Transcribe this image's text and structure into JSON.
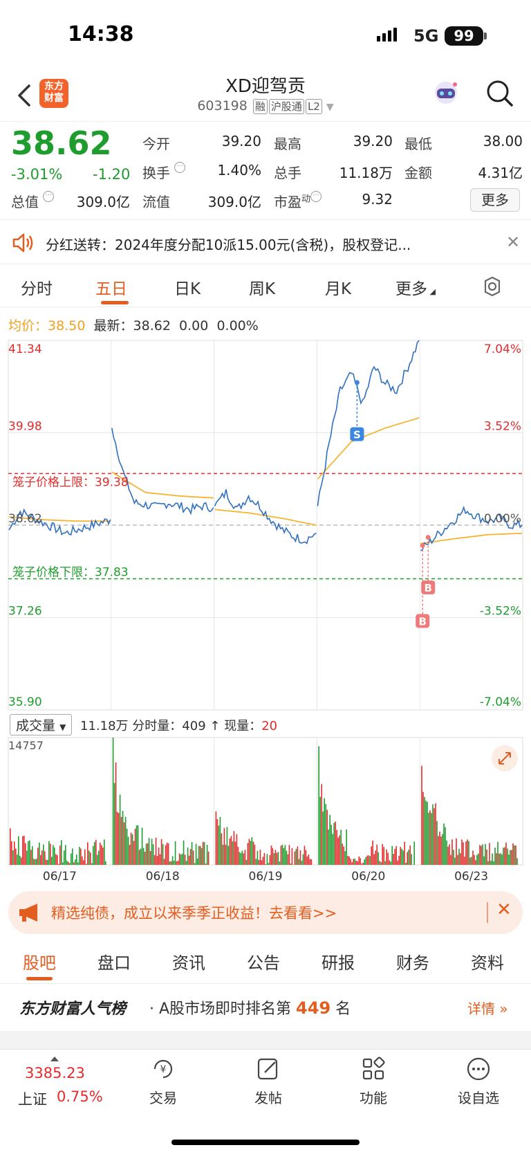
{
  "status_bar": {
    "time": "14:38",
    "network": "5G",
    "battery": "99"
  },
  "header": {
    "logo_line1": "东方",
    "logo_line2": "财富",
    "stock_name": "XD迎驾贡",
    "stock_code": "603198",
    "tags": [
      "融",
      "沪股通",
      "L2"
    ]
  },
  "quote": {
    "price": "38.62",
    "change_pct": "-3.01%",
    "change": "-1.20",
    "open_label": "今开",
    "open": "39.20",
    "high_label": "最高",
    "high": "39.20",
    "low_label": "最低",
    "low": "38.00",
    "turnover_label": "换手",
    "turnover": "1.40%",
    "volume_label": "总手",
    "volume": "11.18万",
    "amount_label": "金额",
    "amount": "4.31亿",
    "mktcap_label": "总值",
    "mktcap": "309.0亿",
    "float_label": "流值",
    "float": "309.0亿",
    "pe_label": "市盈",
    "pe_sup": "动",
    "pe": "9.32",
    "more": "更多"
  },
  "notice": {
    "text": "分红送转：2024年度分配10派15.00元(含税)，股权登记..."
  },
  "chart_tabs": [
    "分时",
    "五日",
    "日K",
    "周K",
    "月K",
    "更多"
  ],
  "stats_line": {
    "avg_label": "均价：",
    "avg": "38.50",
    "latest_label": "最新：",
    "latest": "38.62",
    "chg": "0.00",
    "pct": "0.00%"
  },
  "chart_data": {
    "type": "line",
    "title": "",
    "x": [
      "06/17",
      "06/18",
      "06/19",
      "06/20",
      "06/23"
    ],
    "ylim": [
      35.9,
      41.34
    ],
    "y_ticks_left": [
      "41.34",
      "39.98",
      "38.62",
      "37.26",
      "35.90"
    ],
    "y_ticks_right": [
      "7.04%",
      "3.52%",
      "0.00%",
      "-3.52%",
      "-7.04%"
    ],
    "annotations": {
      "upper_limit": "笼子价格上限：39.38",
      "lower_limit": "笼子价格下限：37.83",
      "sell": "S",
      "buy": "B"
    },
    "reference_lines": {
      "upper": 39.38,
      "lower": 37.83,
      "prev_close": 38.62
    },
    "series": [
      {
        "name": "最新",
        "points_per_day": [
          [
            38.55,
            38.82,
            38.74,
            38.66,
            38.58,
            38.5,
            38.55,
            38.6,
            38.65,
            38.7
          ],
          [
            40.05,
            39.4,
            38.95,
            38.92,
            38.88,
            38.95,
            38.9,
            38.85,
            38.9,
            38.88
          ],
          [
            38.9,
            39.1,
            38.85,
            39.05,
            38.9,
            38.7,
            38.55,
            38.45,
            38.4,
            38.5
          ],
          [
            38.9,
            39.8,
            40.6,
            40.85,
            40.4,
            40.95,
            40.7,
            40.6,
            40.95,
            41.34
          ],
          [
            38.25,
            38.4,
            38.55,
            38.7,
            38.85,
            38.75,
            38.68,
            38.72,
            38.62,
            38.62
          ]
        ]
      },
      {
        "name": "均价",
        "points_per_day": [
          [
            38.74,
            38.7,
            38.68,
            38.68
          ],
          [
            39.4,
            39.1,
            39.05,
            39.02
          ],
          [
            38.85,
            38.8,
            38.72,
            38.62
          ],
          [
            39.3,
            39.85,
            40.05,
            40.2
          ],
          [
            38.35,
            38.42,
            38.48,
            38.5
          ]
        ]
      }
    ]
  },
  "volume": {
    "selector": "成交量",
    "total": "11.18万",
    "tick_label": "分时量：",
    "tick": "409",
    "arrow": "↑",
    "now_label": "现量：",
    "now": "20",
    "y_max": "14757",
    "days": [
      "06/17",
      "06/18",
      "06/19",
      "06/20",
      "06/23"
    ]
  },
  "ad": {
    "text": "精选纯债，成立以来季季正收益！去看看>>"
  },
  "section_tabs": [
    "股吧",
    "盘口",
    "资讯",
    "公告",
    "研报",
    "财务",
    "资料"
  ],
  "rank": {
    "brand": "东方财富人气榜",
    "text_prefix": "· A股市场即时排名第",
    "rank": "449",
    "text_suffix": "名",
    "detail": "详情"
  },
  "bottom_nav": {
    "index_value": "3385.23",
    "index_name": "上证",
    "index_pct": "0.75%",
    "items": [
      "交易",
      "发帖",
      "功能",
      "设自选"
    ]
  },
  "colors": {
    "up": "#e32b2b",
    "down": "#1e9c2e",
    "accent": "#e25d1f",
    "price_line": "#2f6fc0",
    "avg_line": "#f5b431"
  }
}
